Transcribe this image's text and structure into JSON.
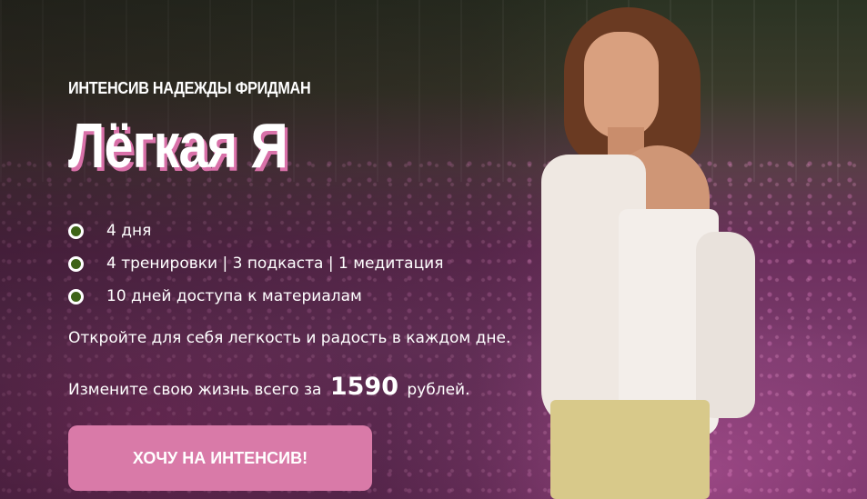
{
  "hero": {
    "kicker": "ИНТЕНСИВ НАДЕЖДЫ ФРИДМАН",
    "title": "Лёгкая Я",
    "features": [
      "4 дня",
      "4 тренировки | 3 подкаста | 1 медитация",
      "10 дней доступа к материалам"
    ],
    "subtitle": "Откройте для себя легкость и радость в каждом дне.",
    "pricing": {
      "prefix": "Измените свою жизнь всего за",
      "amount": "1590",
      "suffix": "рублей."
    },
    "cta_label": "ХОЧУ НА ИНТЕНСИВ!"
  },
  "colors": {
    "accent_pink": "#d97aa8",
    "title_shadow": "#d971a9",
    "bullet_fill": "#3e6417"
  }
}
